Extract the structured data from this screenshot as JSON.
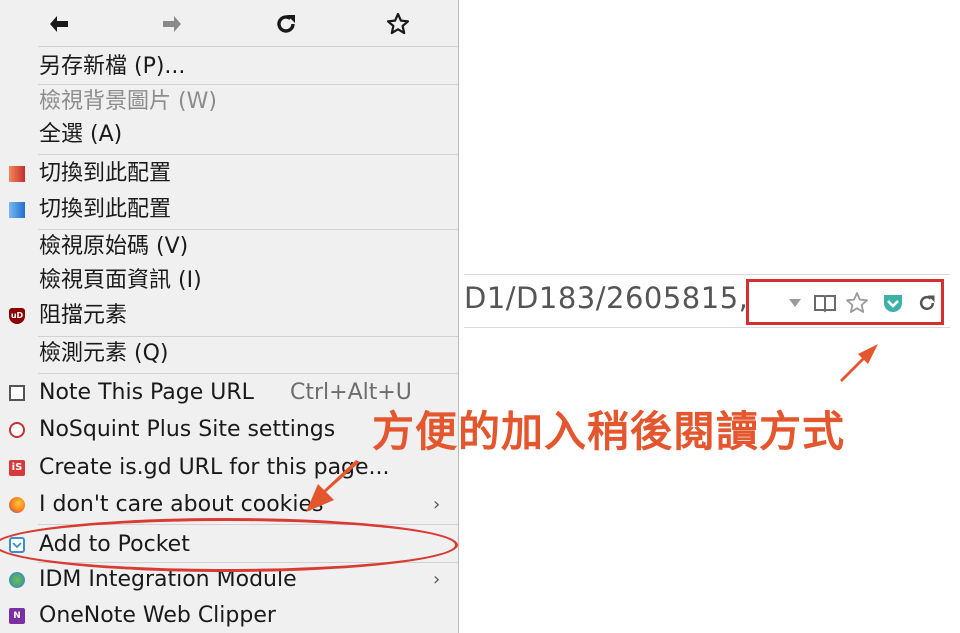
{
  "nav": {
    "back": "🡰",
    "forward": "🡲",
    "reload": "↻",
    "bookmark": "☆"
  },
  "menu": {
    "items": [
      {
        "label": "另存新檔 (P)...",
        "enabled": true
      },
      {
        "label": "檢視背景圖片 (W)",
        "enabled": false
      },
      {
        "label": "全選 (A)",
        "enabled": true
      },
      {
        "label": "切換到此配置",
        "enabled": true,
        "icon": "red-gradient-icon"
      },
      {
        "label": "切換到此配置",
        "enabled": true,
        "icon": "blue-gradient-icon"
      },
      {
        "label": "檢視原始碼 (V)",
        "enabled": true
      },
      {
        "label": "檢視頁面資訊 (I)",
        "enabled": true
      },
      {
        "label": "阻擋元素",
        "enabled": true,
        "icon": "ublock-icon"
      },
      {
        "label": "檢測元素 (Q)",
        "enabled": true
      },
      {
        "label": "Note This Page URL",
        "shortcut": "Ctrl+Alt+U",
        "enabled": true,
        "icon": "note-icon"
      },
      {
        "label": "NoSquint Plus Site settings",
        "enabled": true,
        "icon": "nosquint-icon"
      },
      {
        "label": "Create is.gd URL for this page...",
        "enabled": true,
        "icon": "isgd-icon"
      },
      {
        "label": "I don't care about cookies",
        "enabled": true,
        "icon": "firefox-icon",
        "submenu": "›"
      },
      {
        "label": "Add to Pocket",
        "enabled": true,
        "icon": "pocket-icon"
      },
      {
        "label": "IDM Integration Module",
        "enabled": true,
        "icon": "idm-icon",
        "submenu": "›"
      },
      {
        "label": "OneNote Web Clipper",
        "enabled": true,
        "icon": "onenote-icon"
      }
    ]
  },
  "urlbar": {
    "text": "D1/D183/2605815,"
  },
  "annotation": {
    "caption": "方便的加入稍後閱讀方式",
    "color": "#e4572e"
  },
  "colors": {
    "highlight": "#d62f2f",
    "pocket": "#3eb1a6"
  }
}
